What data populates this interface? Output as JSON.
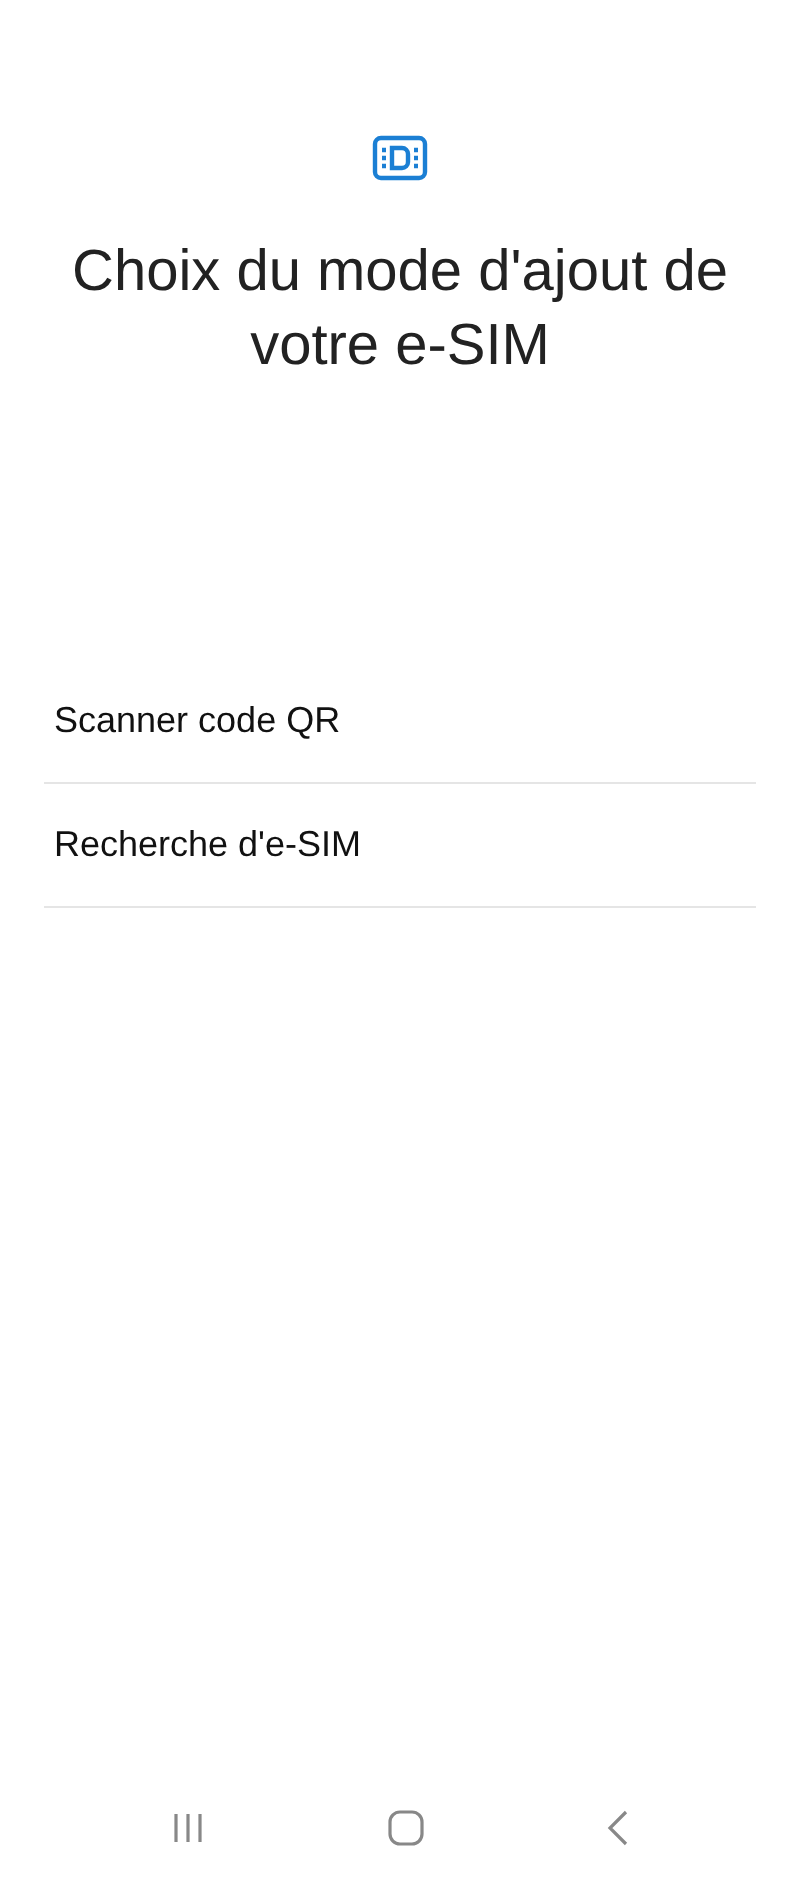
{
  "title": "Choix du mode d'ajout de votre e-SIM",
  "options": [
    {
      "label": "Scanner code QR"
    },
    {
      "label": "Recherche d'e-SIM"
    }
  ]
}
